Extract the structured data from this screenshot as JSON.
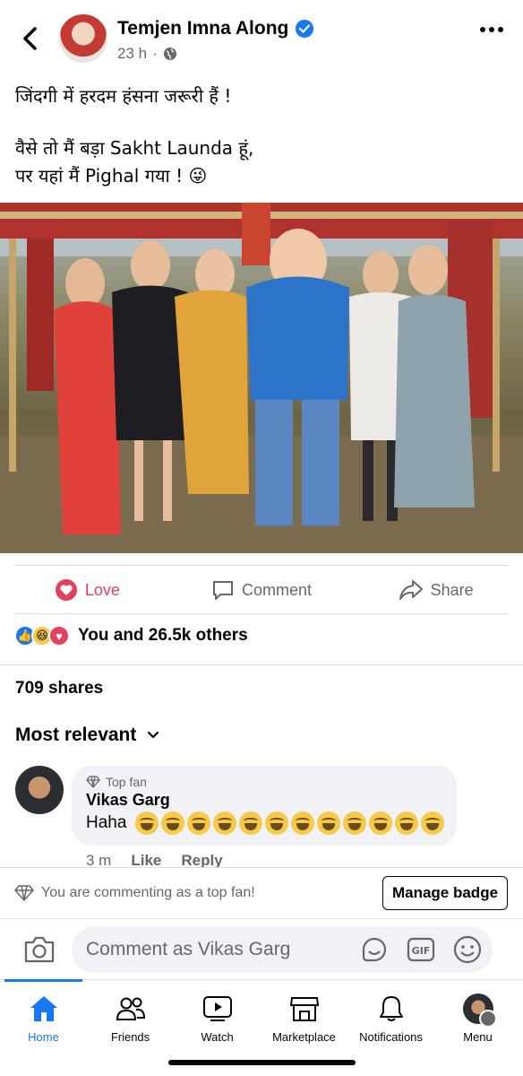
{
  "post": {
    "author": "Temjen Imna Along",
    "time": "23 h",
    "text_line1": "जिंदगी में हरदम हंसना जरूरी हैं !",
    "text_line2": "वैसे तो मैं बड़ा Sakht Launda हूं,",
    "text_line3": "पर यहां मैं Pighal गया ! 😜"
  },
  "actions": {
    "love": "Love",
    "comment": "Comment",
    "share": "Share"
  },
  "reactions": {
    "summary": "You and 26.5k others"
  },
  "shares": "709 shares",
  "sort": {
    "label": "Most relevant"
  },
  "comment": {
    "badge": "Top fan",
    "name": "Vikas Garg",
    "text": "Haha",
    "emoji_count": 12,
    "time": "3 m",
    "like": "Like",
    "reply": "Reply"
  },
  "fan_bar": {
    "text": "You are commenting as a top fan!",
    "button": "Manage badge"
  },
  "composer": {
    "placeholder": "Comment as Vikas Garg"
  },
  "nav": {
    "home": "Home",
    "friends": "Friends",
    "watch": "Watch",
    "marketplace": "Marketplace",
    "notifications": "Notifications",
    "menu": "Menu"
  },
  "colors": {
    "accent": "#1877f2",
    "love": "#e4405f",
    "secondary_text": "#65676b"
  }
}
